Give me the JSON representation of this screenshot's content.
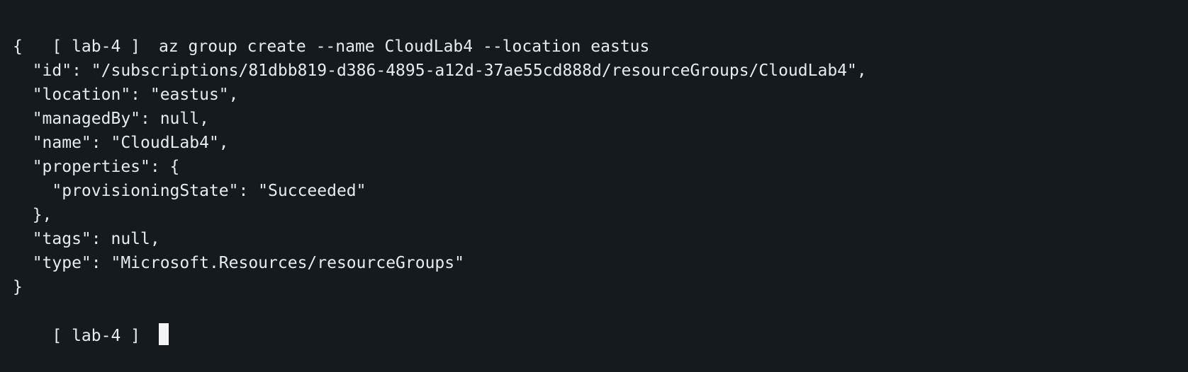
{
  "terminal": {
    "prompt": "[ lab-4 ]",
    "command": "az group create --name CloudLab4 --location eastus",
    "output": [
      "{",
      "  \"id\": \"/subscriptions/81dbb819-d386-4895-a12d-37ae55cd888d/resourceGroups/CloudLab4\",",
      "  \"location\": \"eastus\",",
      "  \"managedBy\": null,",
      "  \"name\": \"CloudLab4\",",
      "  \"properties\": {",
      "    \"provisioningState\": \"Succeeded\"",
      "  },",
      "  \"tags\": null,",
      "  \"type\": \"Microsoft.Resources/resourceGroups\"",
      "}"
    ],
    "next_prompt": "[ lab-4 ]",
    "colors": {
      "background": "#151a1e",
      "text": "#e8ebee",
      "cursor": "#f2f4f6"
    }
  }
}
